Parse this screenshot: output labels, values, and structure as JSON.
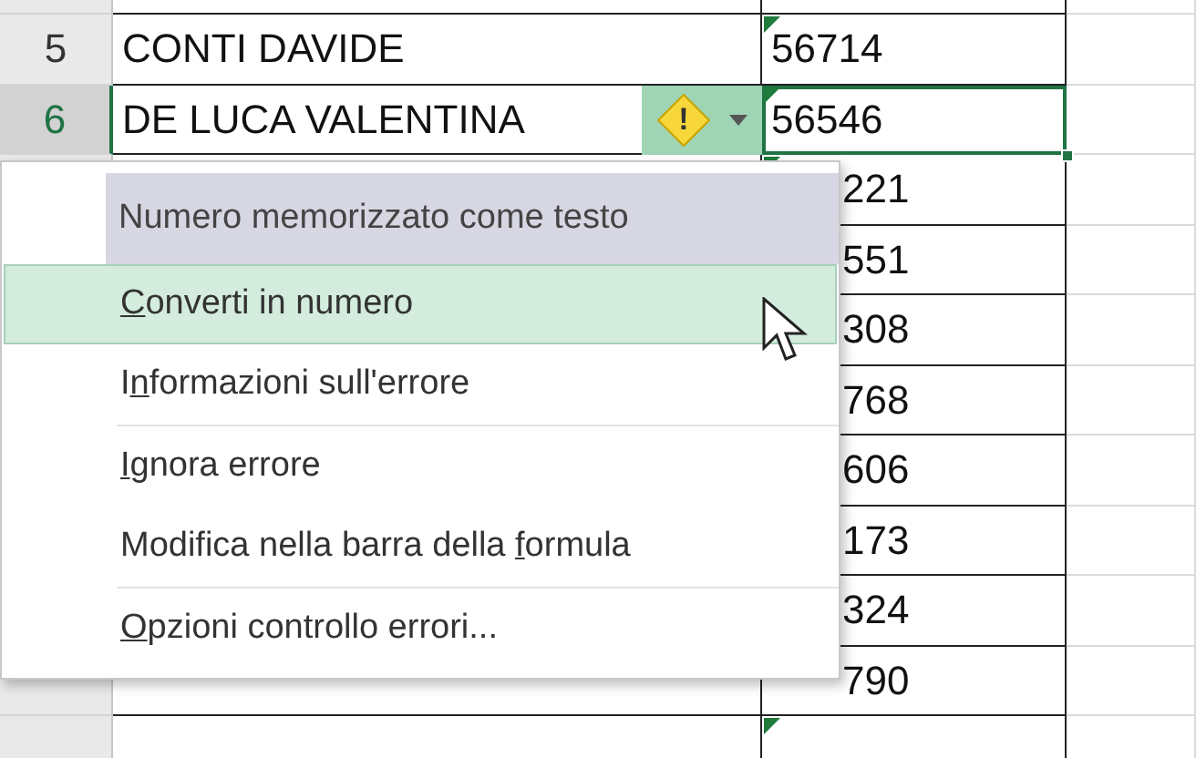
{
  "rows": [
    {
      "kind": "full",
      "number": "5",
      "name": "CONTI DAVIDE",
      "code": "56714",
      "error_flag": true,
      "selected": false
    },
    {
      "kind": "full",
      "number": "6",
      "name": "DE LUCA VALENTINA",
      "code": "56546",
      "error_flag": true,
      "selected": true
    },
    {
      "kind": "covered",
      "code": "221",
      "error_flag": true
    },
    {
      "kind": "covered",
      "code": "551"
    },
    {
      "kind": "covered",
      "code": "308"
    },
    {
      "kind": "covered",
      "code": "768"
    },
    {
      "kind": "covered",
      "code": "606"
    },
    {
      "kind": "covered",
      "code": "173"
    },
    {
      "kind": "covered",
      "code": "324"
    },
    {
      "kind": "partial",
      "code": "790"
    },
    {
      "kind": "cut",
      "error_flag": true
    }
  ],
  "error_button": {
    "symbol": "!"
  },
  "menu": {
    "title": "Numero memorizzato come testo",
    "items": [
      {
        "kind": "item",
        "key": "C",
        "after": "onverti in numero",
        "selected": true
      },
      {
        "kind": "item",
        "before": "I",
        "key": "n",
        "after": "formazioni sull'errore",
        "selected": false
      },
      {
        "kind": "separator"
      },
      {
        "kind": "item",
        "key": "I",
        "after": "gnora errore",
        "selected": false
      },
      {
        "kind": "item",
        "before": "Modifica nella barra della ",
        "key": "f",
        "after": "ormula",
        "selected": false
      },
      {
        "kind": "separator"
      },
      {
        "kind": "item",
        "key": "O",
        "after": "pzioni controllo errori...",
        "selected": false
      }
    ]
  }
}
